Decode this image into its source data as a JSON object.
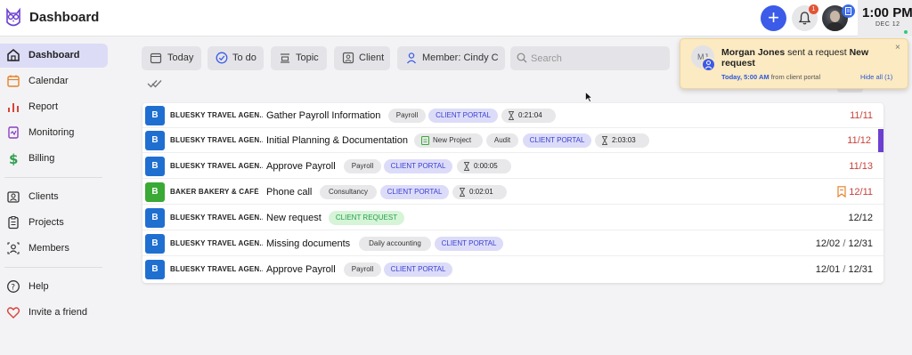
{
  "header": {
    "title": "Dashboard",
    "add_label": "+",
    "notification_count": "1",
    "clock_time": "1:00 PM",
    "clock_date": "DEC 12"
  },
  "sidebar": {
    "items": [
      {
        "label": "Dashboard",
        "icon": "home-icon"
      },
      {
        "label": "Calendar",
        "icon": "calendar-icon"
      },
      {
        "label": "Report",
        "icon": "bar-chart-icon"
      },
      {
        "label": "Monitoring",
        "icon": "monitoring-icon"
      },
      {
        "label": "Billing",
        "icon": "dollar-icon"
      },
      {
        "label": "Clients",
        "icon": "clients-icon"
      },
      {
        "label": "Projects",
        "icon": "clipboard-icon"
      },
      {
        "label": "Members",
        "icon": "members-icon"
      },
      {
        "label": "Help",
        "icon": "help-icon"
      },
      {
        "label": "Invite a friend",
        "icon": "heart-icon"
      }
    ]
  },
  "filters": {
    "today": "Today",
    "todo": "To do",
    "topic": "Topic",
    "client": "Client",
    "member": "Member: Cindy C",
    "search_placeholder": "Search"
  },
  "tasks": [
    {
      "avatar": "B",
      "client": "BLUESKY TRAVEL AGEN...",
      "title": "Gather Payroll Information",
      "tags": [
        "Payroll",
        "CLIENT PORTAL"
      ],
      "timer": "0:21:04",
      "due": "11/11"
    },
    {
      "avatar": "B",
      "client": "BLUESKY TRAVEL AGEN...",
      "title": "Initial Planning & Documentation",
      "tags": [
        "New Project",
        "Audit",
        "CLIENT PORTAL"
      ],
      "timer": "2:03:03",
      "due": "11/12"
    },
    {
      "avatar": "B",
      "client": "BLUESKY TRAVEL AGEN...",
      "title": "Approve Payroll",
      "tags": [
        "Payroll",
        "CLIENT PORTAL"
      ],
      "timer": "0:00:05",
      "due": "11/13"
    },
    {
      "avatar": "B",
      "client": "BAKER BAKERY & CAFÉ",
      "title": "Phone call",
      "tags": [
        "Consultancy",
        "CLIENT PORTAL"
      ],
      "timer": "0:02:01",
      "due": "12/11"
    },
    {
      "avatar": "B",
      "client": "BLUESKY TRAVEL AGEN...",
      "title": "New request",
      "tags": [
        "CLIENT REQUEST"
      ],
      "due": "12/12"
    },
    {
      "avatar": "B",
      "client": "BLUESKY TRAVEL AGEN...",
      "title": "Missing documents",
      "tags": [
        "Daily accounting",
        "CLIENT PORTAL"
      ],
      "start": "12/02",
      "sep": "/",
      "due": "12/31"
    },
    {
      "avatar": "B",
      "client": "BLUESKY TRAVEL AGEN...",
      "title": "Approve Payroll",
      "tags": [
        "Payroll",
        "CLIENT PORTAL"
      ],
      "start": "12/01",
      "sep": "/",
      "due": "12/31"
    }
  ],
  "notification": {
    "avatar_initials": "MJ",
    "sender": "Morgan Jones",
    "message": " sent a request ",
    "subject": "New request",
    "time": "Today, 5:00 AM",
    "source": " from client portal",
    "hide_all": "Hide all (1)",
    "close": "×"
  },
  "colors": {
    "accent": "#3b5be8",
    "overdue": "#c8413a",
    "client_portal_tag": "#dcdcf9",
    "client_request_tag": "#d6f4d8",
    "notification_bg": "#fbeac2"
  }
}
